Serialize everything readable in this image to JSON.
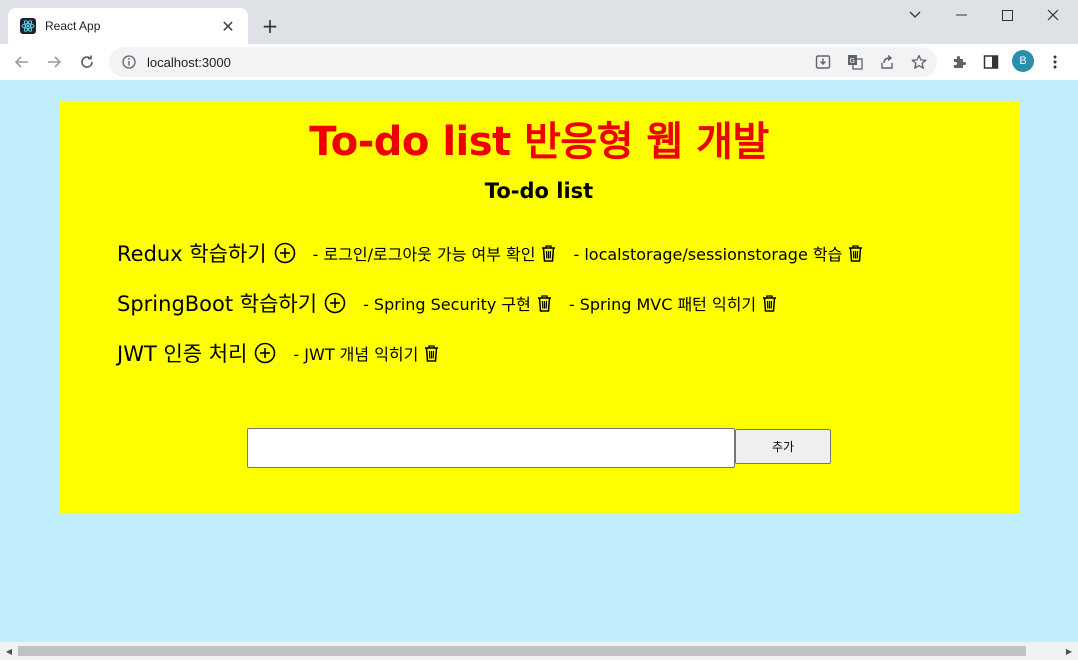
{
  "browser": {
    "tab_title": "React App",
    "url": "localhost:3000",
    "profile_initial": "B"
  },
  "page": {
    "title": "To-do list 반응형 웹 개발",
    "subtitle": "To-do list",
    "todos": [
      {
        "label": "Redux 학습하기",
        "subs": [
          "- 로그인/로그아웃 가능 여부 확인",
          "- localstorage/sessionstorage 학습"
        ]
      },
      {
        "label": "SpringBoot 학습하기",
        "subs": [
          "- Spring Security 구현",
          "- Spring MVC 패턴 익히기"
        ]
      },
      {
        "label": "JWT 인증 처리",
        "subs": [
          "- JWT 개념 익히기"
        ]
      }
    ],
    "input_value": "",
    "add_button_label": "추가"
  },
  "colors": {
    "page_background": "#c1eefd",
    "panel_background": "#ffff00",
    "title_color": "#ee0000"
  }
}
